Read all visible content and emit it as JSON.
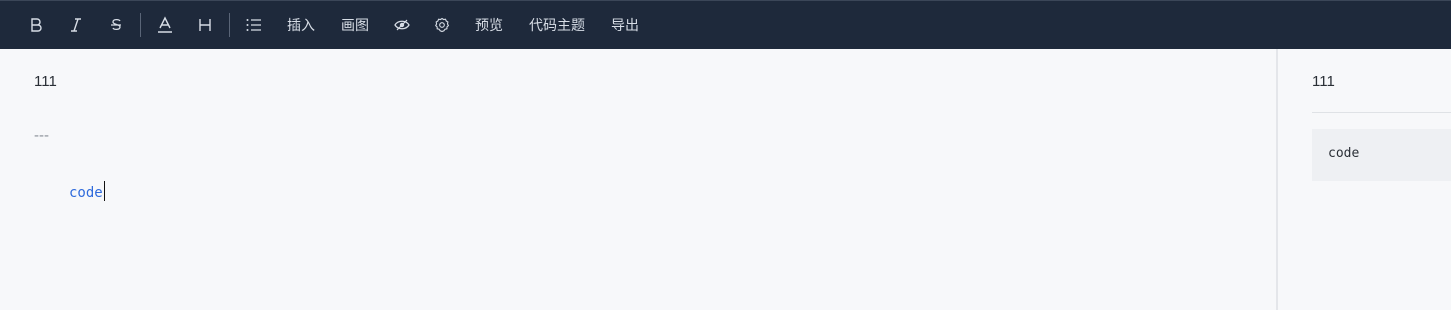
{
  "toolbar": {
    "bold_icon": "bold-icon",
    "italic_icon": "italic-icon",
    "strike_icon": "strikethrough-icon",
    "color_icon": "text-color-icon",
    "heading_icon": "heading-icon",
    "list_icon": "list-icon",
    "insert_label": "插入",
    "draw_label": "画图",
    "eye_icon": "eye-icon",
    "settings_icon": "gear-icon",
    "preview_label": "预览",
    "code_theme_label": "代码主题",
    "export_label": "导出",
    "background_color": "#1e293b"
  },
  "editor": {
    "lines": [
      "111",
      "---",
      "code"
    ]
  },
  "preview": {
    "paragraph": "111",
    "code_block": "code"
  }
}
